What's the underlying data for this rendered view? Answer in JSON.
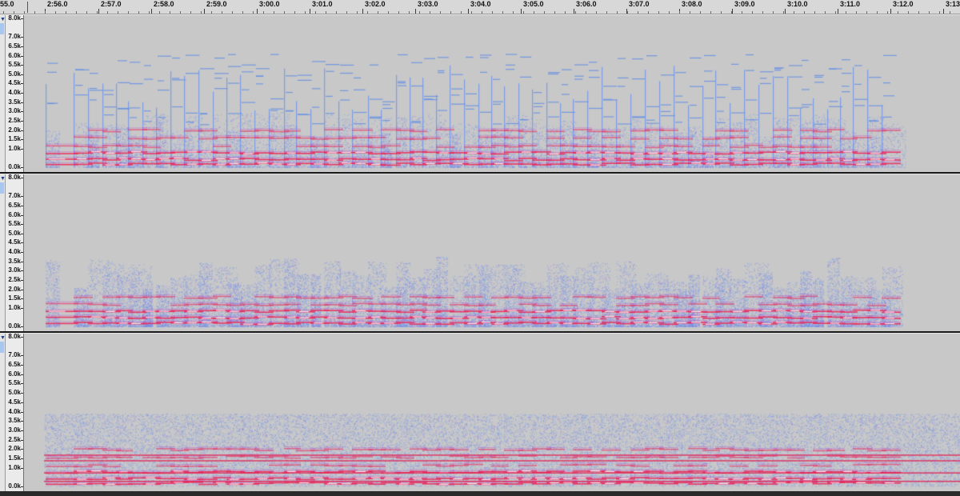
{
  "timeline": {
    "labels": [
      "55.0",
      "2:56.0",
      "2:57.0",
      "2:58.0",
      "2:59.0",
      "3:00.0",
      "3:01.0",
      "3:02.0",
      "3:03.0",
      "3:04.0",
      "3:05.0",
      "3:06.0",
      "3:07.0",
      "3:08.0",
      "3:09.0",
      "3:10.0",
      "3:11.0",
      "3:12.0",
      "3:13"
    ]
  },
  "tracks": [
    {
      "id": "track-1",
      "freq_labels": [
        "8.0k",
        "7.0k",
        "6.5k",
        "6.0k",
        "5.5k",
        "5.0k",
        "4.5k",
        "4.0k",
        "3.5k",
        "3.0k",
        "2.5k",
        "2.0k",
        "1.5k",
        "1.0k",
        "0.0k"
      ]
    },
    {
      "id": "track-2",
      "freq_labels": [
        "8.0k",
        "7.0k",
        "6.5k",
        "6.0k",
        "5.5k",
        "5.0k",
        "4.5k",
        "4.0k",
        "3.5k",
        "3.0k",
        "2.5k",
        "2.0k",
        "1.5k",
        "1.0k",
        "0.0k"
      ]
    },
    {
      "id": "track-3",
      "freq_labels": [
        "8.0k",
        "7.0k",
        "6.5k",
        "6.0k",
        "5.5k",
        "5.0k",
        "4.5k",
        "4.0k",
        "3.5k",
        "3.0k",
        "2.5k",
        "2.0k",
        "1.5k",
        "1.0k",
        "0.0k"
      ]
    }
  ],
  "colors": {
    "background": "#c8c8c8",
    "spectrum_low": "#7aa8ee",
    "spectrum_mid": "#9a76e4",
    "spectrum_high": "#ee2f5f",
    "spectrum_peak": "#ffffff"
  }
}
